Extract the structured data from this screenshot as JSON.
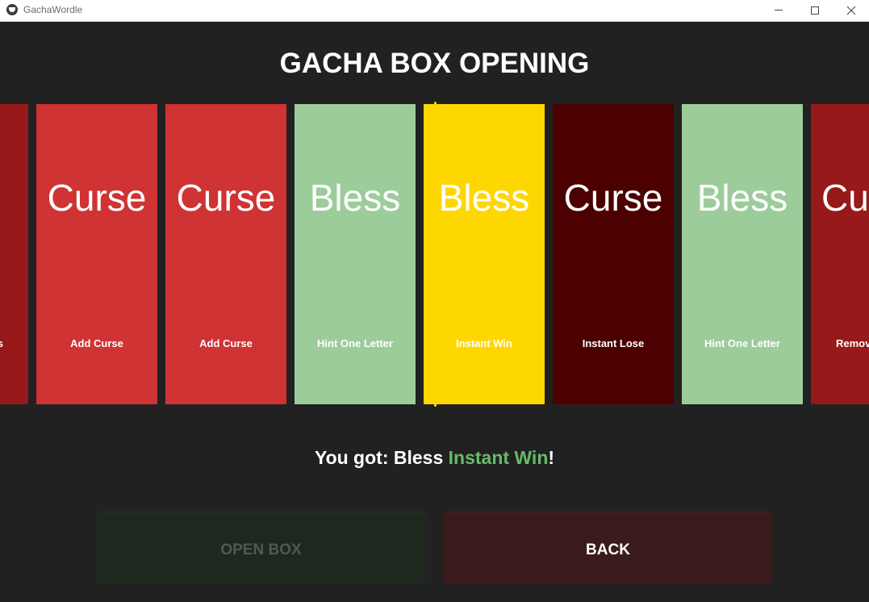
{
  "window": {
    "title": "GachaWordle"
  },
  "page": {
    "heading": "GACHA BOX OPENING"
  },
  "cards": [
    {
      "type": "Curse",
      "effect": "Remove Bless",
      "type_visible": "e",
      "effect_visible": "s",
      "color": "#971919"
    },
    {
      "type": "Curse",
      "effect": "Add Curse",
      "color": "#cf3333"
    },
    {
      "type": "Curse",
      "effect": "Add Curse",
      "color": "#cf3333"
    },
    {
      "type": "Bless",
      "effect": "Hint One Letter",
      "color": "#9ccc9a"
    },
    {
      "type": "Bless",
      "effect": "Instant Win",
      "color": "#ffd700",
      "selected": true
    },
    {
      "type": "Curse",
      "effect": "Instant Lose",
      "color": "#4c0000"
    },
    {
      "type": "Bless",
      "effect": "Hint One Letter",
      "color": "#9ccc9a"
    },
    {
      "type": "Curse",
      "effect": "Remove",
      "type_visible": "Cu",
      "effect_visible": "Remov",
      "color": "#971919"
    }
  ],
  "result": {
    "prefix": "You got: Bless ",
    "highlight": "Instant Win",
    "suffix": "!",
    "highlight_color": "#66bb6a"
  },
  "buttons": {
    "open_box": "OPEN BOX",
    "back": "BACK"
  }
}
